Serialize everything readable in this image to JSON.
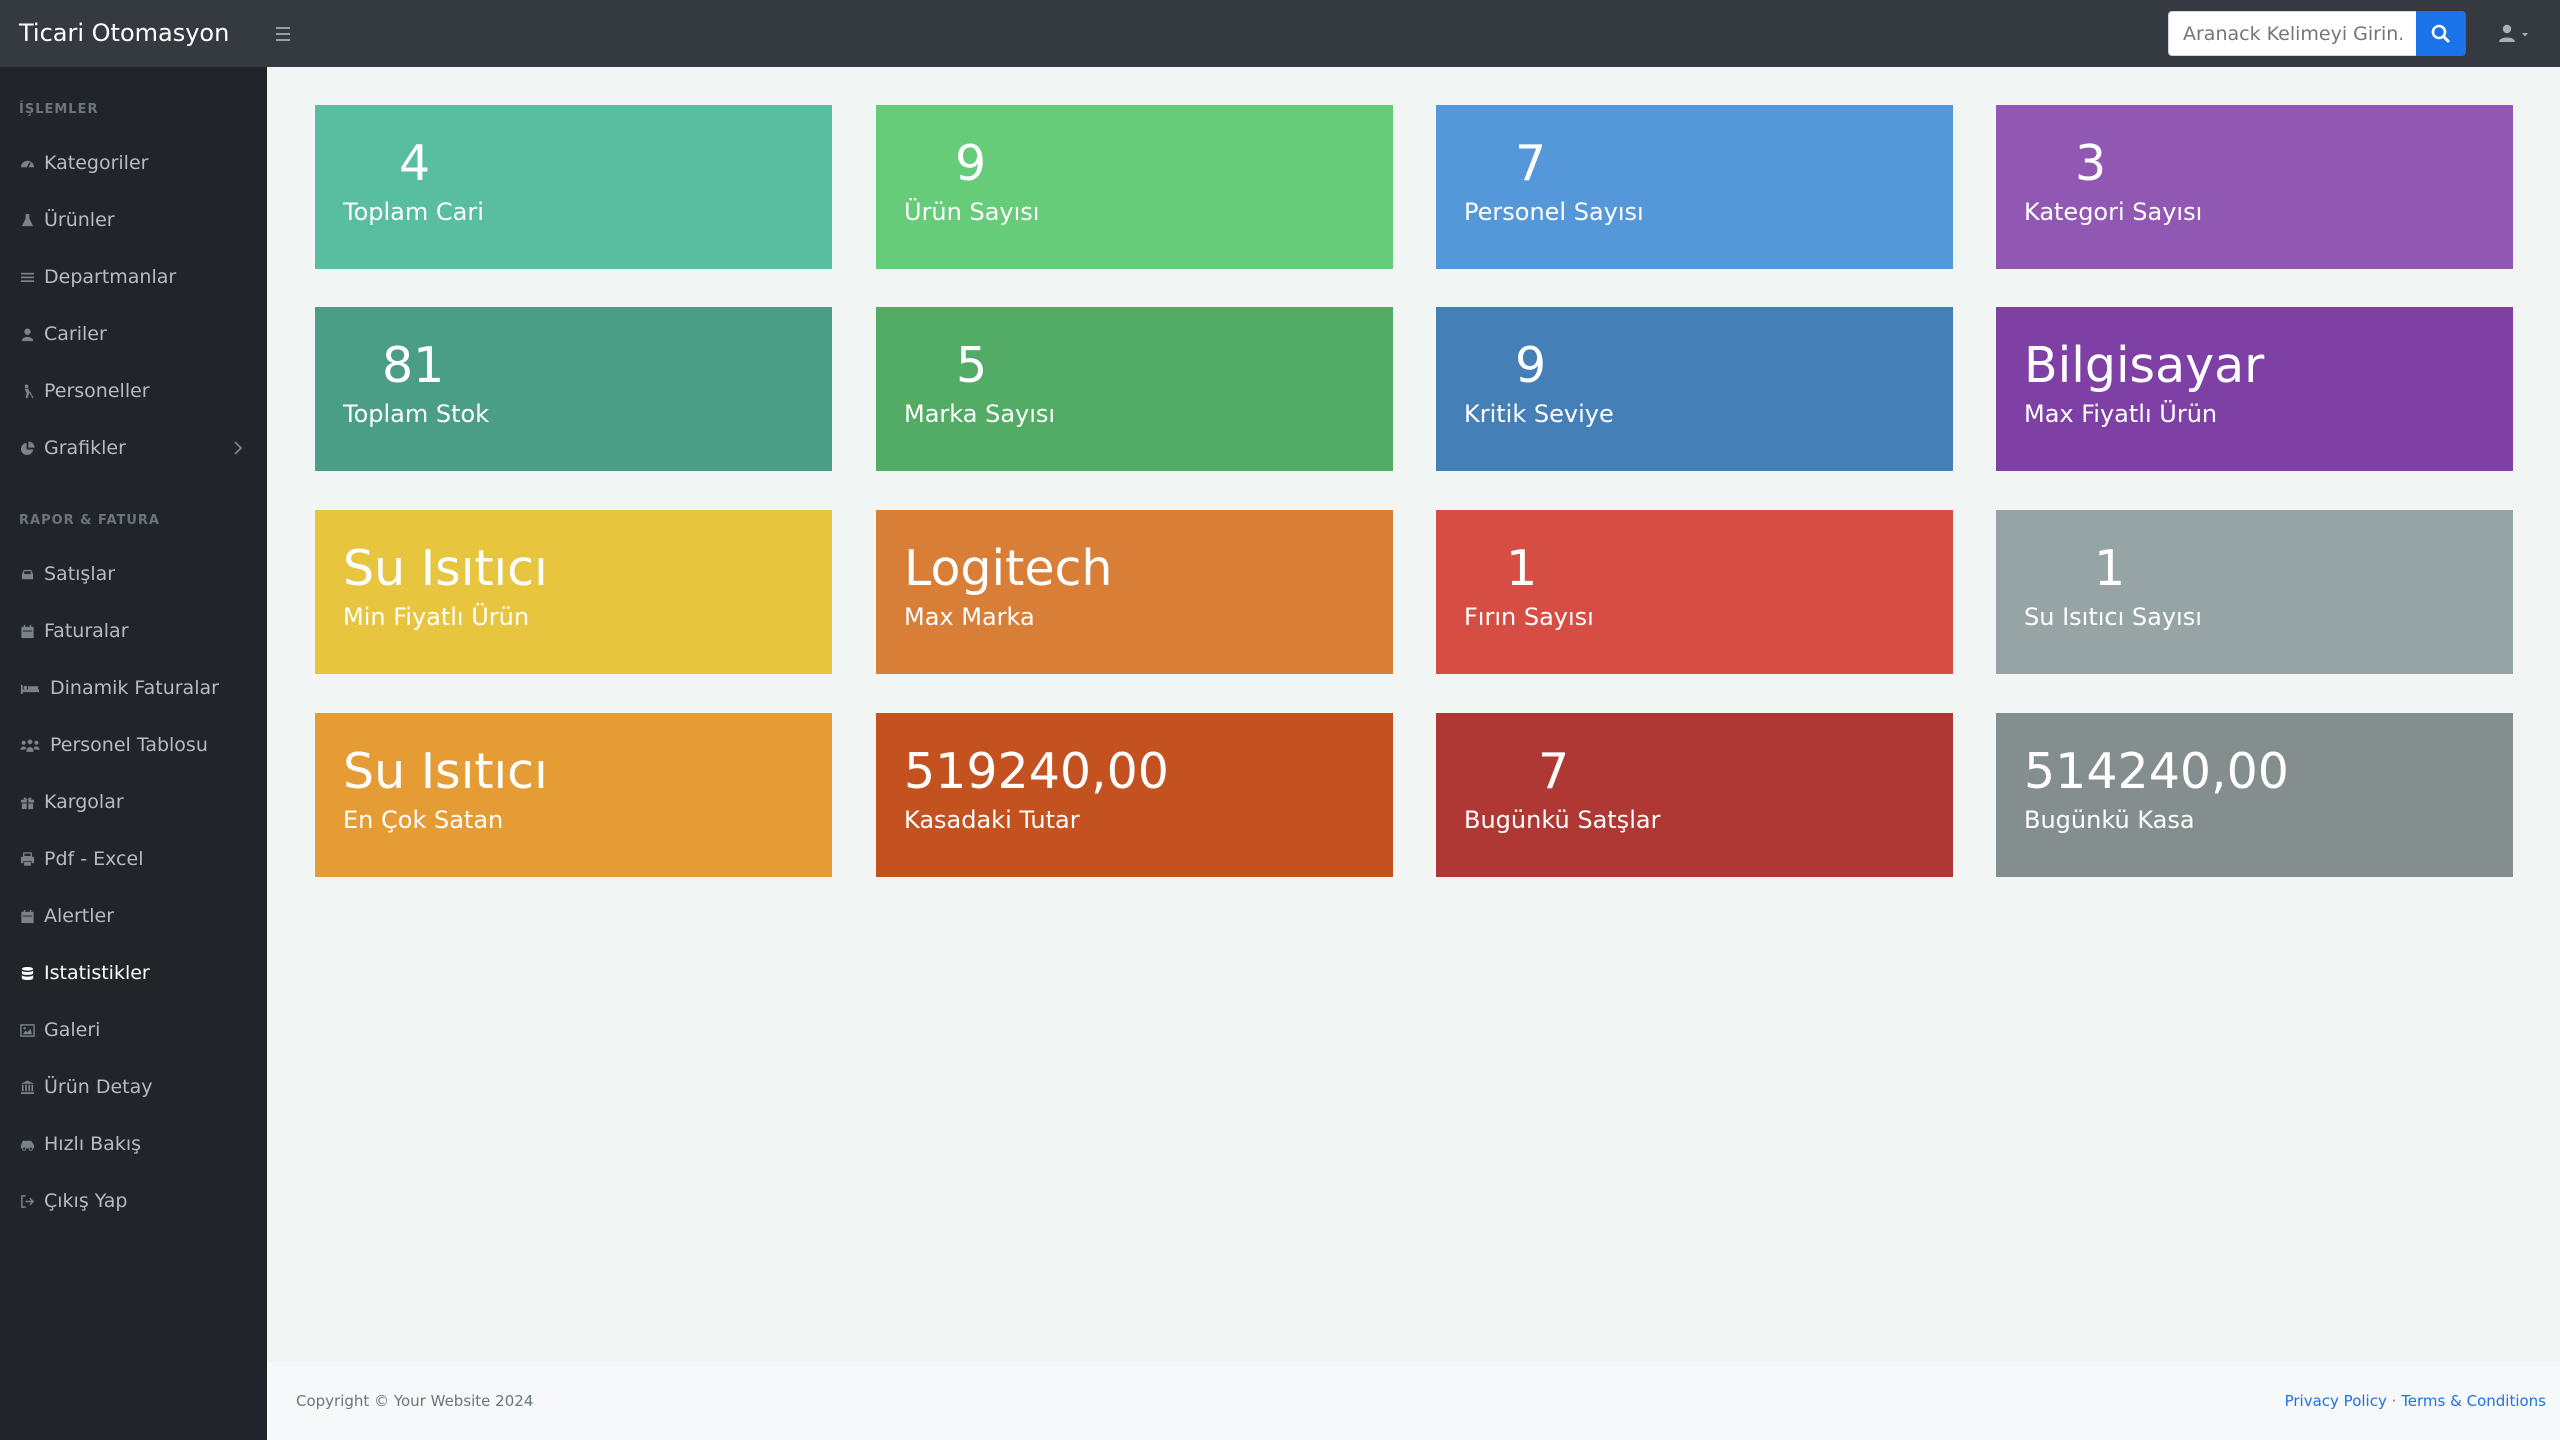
{
  "app": {
    "title": "Ticari Otomasyon"
  },
  "search": {
    "placeholder": "Aranack Kelimeyi Girin..."
  },
  "sidebar": {
    "sections": [
      {
        "title": "İŞLEMLER"
      },
      {
        "title": "RAPOR & FATURA"
      }
    ],
    "items": [
      {
        "label": "Kategoriler",
        "icon": "dashboard-icon"
      },
      {
        "label": "Ürünler",
        "icon": "flask-icon"
      },
      {
        "label": "Departmanlar",
        "icon": "list-icon"
      },
      {
        "label": "Cariler",
        "icon": "user-icon"
      },
      {
        "label": "Personeller",
        "icon": "blind-person-icon"
      },
      {
        "label": "Grafikler",
        "icon": "pie-chart-icon"
      },
      {
        "label": "Satışlar",
        "icon": "car-icon"
      },
      {
        "label": "Faturalar",
        "icon": "calendar-icon"
      },
      {
        "label": "Dinamik Faturalar",
        "icon": "bed-icon"
      },
      {
        "label": "Personel Tablosu",
        "icon": "users-icon"
      },
      {
        "label": "Kargolar",
        "icon": "gift-icon"
      },
      {
        "label": "Pdf - Excel",
        "icon": "print-icon"
      },
      {
        "label": "Alertler",
        "icon": "calendar-check-icon"
      },
      {
        "label": "Istatistikler",
        "icon": "database-icon",
        "active": true
      },
      {
        "label": "Galeri",
        "icon": "image-icon"
      },
      {
        "label": "Ürün Detay",
        "icon": "bank-icon"
      },
      {
        "label": "Hızlı Bakış",
        "icon": "car-side-icon"
      },
      {
        "label": "Çıkış Yap",
        "icon": "sign-out-icon"
      }
    ]
  },
  "stats": [
    {
      "value": "4",
      "label": "Toplam Cari",
      "color": "#59bd9f"
    },
    {
      "value": "9",
      "label": "Ürün Sayısı",
      "color": "#66cc79"
    },
    {
      "value": "7",
      "label": "Personel Sayısı",
      "color": "#5598d9"
    },
    {
      "value": "3",
      "label": "Kategori Sayısı",
      "color": "#9057b3"
    },
    {
      "value": "81",
      "label": "Toplam Stok",
      "color": "#4b9e86"
    },
    {
      "value": "5",
      "label": "Marka Sayısı",
      "color": "#53ac65"
    },
    {
      "value": "9",
      "label": "Kritik Seviye",
      "color": "#447fb8"
    },
    {
      "value": "Bilgisayar",
      "label": "Max Fiyatlı Ürün",
      "color": "#7f40a6"
    },
    {
      "value": "Su Isıtıcı",
      "label": "Min Fiyatlı Ürün",
      "color": "#e8c53f"
    },
    {
      "value": "Logitech",
      "label": "Max Marka",
      "color": "#d87e37"
    },
    {
      "value": "1",
      "label": "Fırın Sayısı",
      "color": "#d64d44"
    },
    {
      "value": "1",
      "label": "Su Isıtıcı Sayısı",
      "color": "#97a4a5"
    },
    {
      "value": "Su Isıtıcı",
      "label": "En Çok Satan",
      "color": "#e69c35"
    },
    {
      "value": "519240,00",
      "label": "Kasadaki Tutar",
      "color": "#c45220"
    },
    {
      "value": "7",
      "label": "Bugünkü Satşlar",
      "color": "#b03834"
    },
    {
      "value": "514240,00",
      "label": "Bugünkü Kasa",
      "color": "#848e8e"
    }
  ],
  "footer": {
    "copyright": "Copyright © Your Website 2024",
    "privacy": "Privacy Policy",
    "separator": "·",
    "terms": "Terms & Conditions"
  },
  "colors": {
    "navbar": "#343a40",
    "sidebar": "#212529",
    "accent": "#1a73e8",
    "background": "#f1f6f4"
  }
}
